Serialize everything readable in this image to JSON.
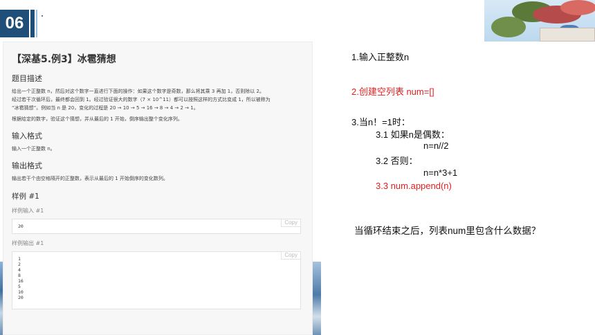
{
  "header": {
    "badge": "06",
    "marker": "."
  },
  "problem": {
    "title": "【深基5.例3】冰雹猜想",
    "desc_heading": "题目描述",
    "desc_lines": [
      "给出一个正整数 n，然后对这个数字一直进行下面的操作：如果这个数字是奇数，那么将其乘 3 再加 1，否则除以 2。",
      "经过若干次循环后，最终都会回到 1。经过验证很大的数字（7 × 10^11）都可以按照这样的方式比变成 1，所以被称为",
      "“冰雹猜想”。例如当 n 是 20，变化的过程是 20 → 10 → 5 → 16 → 8 → 4 → 2 → 1。"
    ],
    "desc_extra": "根据给定的数字，验证这个猜想，并从最后的 1 开始，倒序输出整个变化序列。",
    "input_heading": "输入格式",
    "input_text": "输入一个正整数 n。",
    "output_heading": "输出格式",
    "output_text": "输出若干个由空格隔开的正整数，表示从最后的 1 开始倒序的变化数列。",
    "sample_title": "样例 #1",
    "sample_input_label": "样例输入 #1",
    "sample_input": "20",
    "sample_output_label": "样例输出 #1",
    "sample_output": [
      "1",
      "2",
      "4",
      "8",
      "16",
      "5",
      "10",
      "20"
    ],
    "copy_label": "Copy"
  },
  "steps": {
    "s1": "1.输入正整数n",
    "s2": "2.创建空列表  num=[]",
    "s3": "3.当n！=1时：",
    "s31": "3.1   如果n是偶数：",
    "s31_code": "n=n//2",
    "s32": "3.2    否则：",
    "s32_code": "n=n*3+1",
    "s33": "3.3    num.append(n)",
    "question": "当循环结束之后，列表num里包含什么数据？"
  },
  "colors": {
    "accent": "#1f4e79",
    "highlight": "#e02020"
  }
}
